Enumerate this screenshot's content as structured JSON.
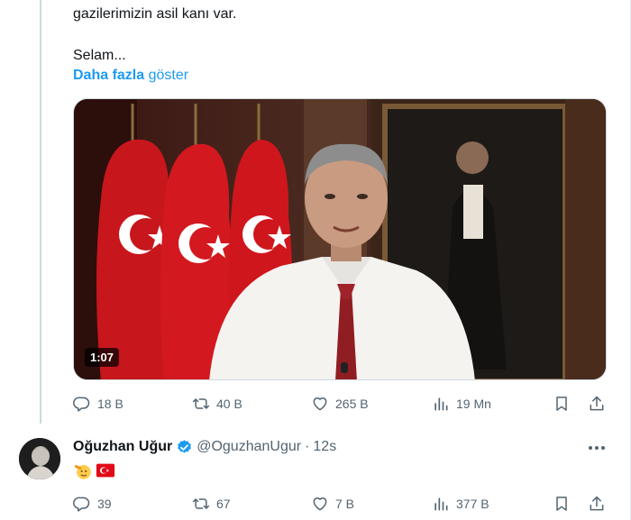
{
  "tweet": {
    "text_line": "gazilerimizin asil kanı var.",
    "text_greeting": "Selam...",
    "show_more_bold": "Daha fazla",
    "show_more_rest": " göster",
    "video": {
      "duration": "1:07"
    },
    "metrics": {
      "replies": "18 B",
      "reposts": "40 B",
      "likes": "265 B",
      "views": "19 Mn"
    }
  },
  "reply": {
    "author_name": "Oğuzhan Uğur",
    "author_handle": "@OguzhanUgur",
    "separator": "·",
    "time": "12s",
    "metrics": {
      "replies": "39",
      "reposts": "67",
      "likes": "7 B",
      "views": "377 B"
    }
  },
  "colors": {
    "accent": "#1d9bf0",
    "muted": "#536471",
    "text": "#0f1419",
    "flag_red": "#e30a17"
  },
  "icons": [
    "reply-icon",
    "repost-icon",
    "like-icon",
    "views-icon",
    "bookmark-icon",
    "share-icon",
    "verified-badge-icon",
    "more-icon"
  ]
}
